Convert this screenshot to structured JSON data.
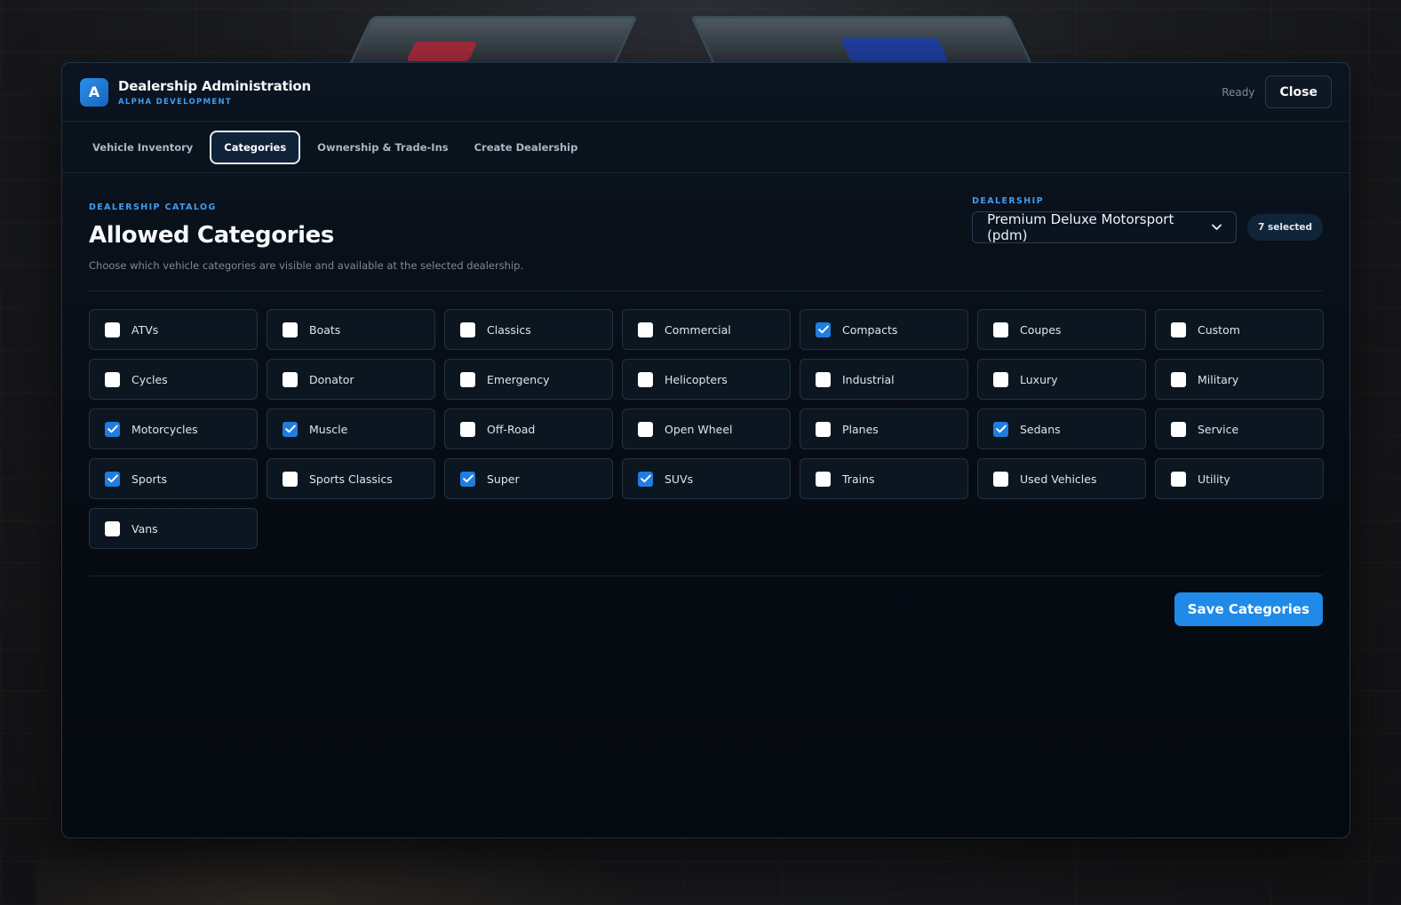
{
  "app": {
    "logo_letter": "A",
    "title": "Dealership Administration",
    "subtitle": "ALPHA DEVELOPMENT",
    "status": "Ready",
    "close_label": "Close"
  },
  "tabs": [
    {
      "label": "Vehicle Inventory",
      "active": false
    },
    {
      "label": "Categories",
      "active": true
    },
    {
      "label": "Ownership & Trade-Ins",
      "active": false
    },
    {
      "label": "Create Dealership",
      "active": false
    }
  ],
  "section": {
    "eyebrow": "DEALERSHIP CATALOG",
    "title": "Allowed Categories",
    "description": "Choose which vehicle categories are visible and available at the selected dealership."
  },
  "dealership": {
    "label": "DEALERSHIP",
    "selected": "Premium Deluxe Motorsport (pdm)",
    "selected_count": "7 selected"
  },
  "categories": [
    {
      "label": "ATVs",
      "checked": false
    },
    {
      "label": "Boats",
      "checked": false
    },
    {
      "label": "Classics",
      "checked": false
    },
    {
      "label": "Commercial",
      "checked": false
    },
    {
      "label": "Compacts",
      "checked": true
    },
    {
      "label": "Coupes",
      "checked": false
    },
    {
      "label": "Custom",
      "checked": false
    },
    {
      "label": "Cycles",
      "checked": false
    },
    {
      "label": "Donator",
      "checked": false
    },
    {
      "label": "Emergency",
      "checked": false
    },
    {
      "label": "Helicopters",
      "checked": false
    },
    {
      "label": "Industrial",
      "checked": false
    },
    {
      "label": "Luxury",
      "checked": false
    },
    {
      "label": "Military",
      "checked": false
    },
    {
      "label": "Motorcycles",
      "checked": true
    },
    {
      "label": "Muscle",
      "checked": true
    },
    {
      "label": "Off-Road",
      "checked": false
    },
    {
      "label": "Open Wheel",
      "checked": false
    },
    {
      "label": "Planes",
      "checked": false
    },
    {
      "label": "Sedans",
      "checked": true
    },
    {
      "label": "Service",
      "checked": false
    },
    {
      "label": "Sports",
      "checked": true
    },
    {
      "label": "Sports Classics",
      "checked": false
    },
    {
      "label": "Super",
      "checked": true
    },
    {
      "label": "SUVs",
      "checked": true
    },
    {
      "label": "Trains",
      "checked": false
    },
    {
      "label": "Used Vehicles",
      "checked": false
    },
    {
      "label": "Utility",
      "checked": false
    },
    {
      "label": "Vans",
      "checked": false
    }
  ],
  "actions": {
    "save_label": "Save Categories"
  },
  "colors": {
    "accent": "#1f8ae8",
    "eyebrow": "#3f9cf2",
    "panel_bg": "#060b12",
    "checkbox_checked": "#1f7de0"
  }
}
